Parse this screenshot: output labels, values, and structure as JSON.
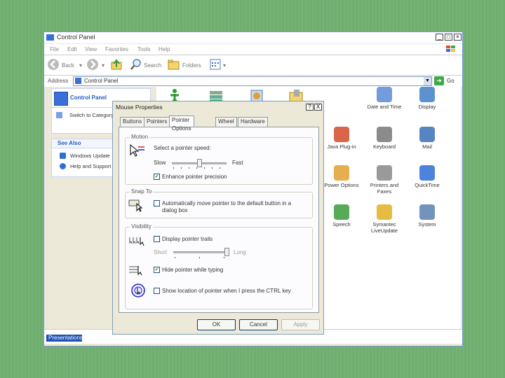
{
  "control_panel": {
    "title": "Control Panel",
    "menu": [
      "File",
      "Edit",
      "View",
      "Favorites",
      "Tools",
      "Help"
    ],
    "toolbar": {
      "back": "Back",
      "search": "Search",
      "folders": "Folders"
    },
    "address": {
      "label": "Address",
      "value": "Control Panel",
      "go": "Go"
    },
    "left_panel": {
      "title": "Control Panel",
      "switch_link": "Switch to Category View",
      "see_also_title": "See Also",
      "see_also": [
        "Windows Update",
        "Help and Support"
      ]
    },
    "items": [
      {
        "label": "Date and Time",
        "icon": "clock-icon"
      },
      {
        "label": "Display",
        "icon": "display-icon"
      },
      {
        "label": "Java Plug-in",
        "icon": "java-icon"
      },
      {
        "label": "Keyboard",
        "icon": "keyboard-icon"
      },
      {
        "label": "Mail",
        "icon": "mail-icon"
      },
      {
        "label": "Power Options",
        "icon": "power-icon"
      },
      {
        "label": "Printers and Faxes",
        "icon": "printer-icon"
      },
      {
        "label": "QuickTime",
        "icon": "quicktime-icon"
      },
      {
        "label": "Speech",
        "icon": "speech-icon"
      },
      {
        "label": "Symantec LiveUpdate",
        "icon": "liveupdate-icon"
      },
      {
        "label": "System",
        "icon": "system-icon"
      }
    ],
    "taskbar_item": "Presentations"
  },
  "dialog": {
    "title": "Mouse Properties",
    "help_btn": "?",
    "close_btn": "X",
    "tabs": [
      "Buttons",
      "Pointers",
      "Pointer Options",
      "Wheel",
      "Hardware"
    ],
    "active_tab": "Pointer Options",
    "motion": {
      "title": "Motion",
      "label": "Select a pointer speed:",
      "slow": "Slow",
      "fast": "Fast",
      "speed_fraction": 0.5,
      "enhance_label": "Enhance pointer precision",
      "enhance_checked": true
    },
    "snap": {
      "title": "Snap To",
      "label_line1": "Automatically move pointer to the default button in a",
      "label_line2": "dialog box",
      "checked": false
    },
    "visibility": {
      "title": "Visibility",
      "trails_label": "Display pointer trails",
      "trails_checked": false,
      "short": "Short",
      "long": "Long",
      "trail_fraction": 1.0,
      "hide_label": "Hide pointer while typing",
      "hide_checked": true,
      "ctrl_label": "Show location of pointer when I press the CTRL key",
      "ctrl_checked": false
    },
    "buttons": {
      "ok": "OK",
      "cancel": "Cancel",
      "apply": "Apply"
    }
  },
  "colors": {
    "desktop": "#6fae6f",
    "xp_blue": "#215dc6",
    "title_blue": "#1c4fb0"
  }
}
